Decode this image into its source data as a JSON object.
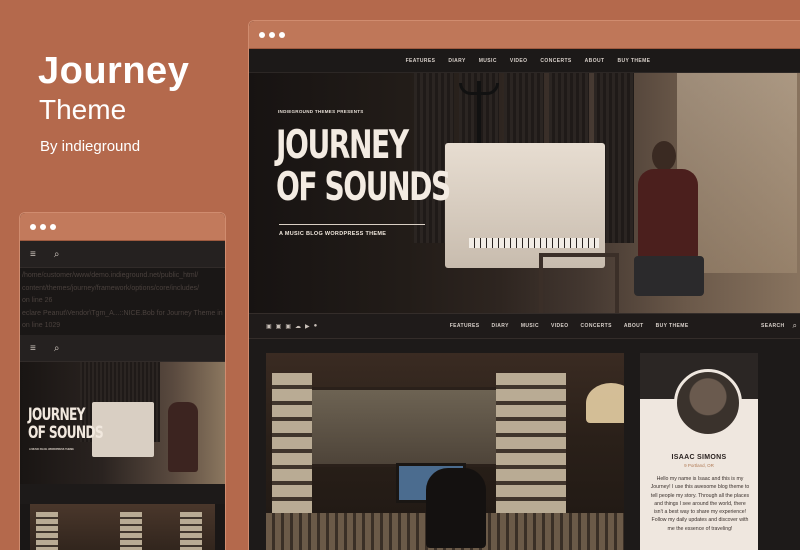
{
  "brand": {
    "title": "Journey",
    "subtitle": "Theme",
    "byline": "By indieground"
  },
  "desktop": {
    "top_nav": [
      "FEATURES",
      "DIARY",
      "MUSIC",
      "VIDEO",
      "CONCERTS",
      "ABOUT",
      "BUY THEME"
    ],
    "hero": {
      "presents": "INDIEGROUND THEMES PRESENTS",
      "title_line1": "JOURNEY",
      "title_line2": "OF SOUNDS",
      "tagline": "A MUSIC BLOG WORDPRESS THEME"
    },
    "sub_nav": [
      "FEATURES",
      "DIARY",
      "MUSIC",
      "VIDEO",
      "CONCERTS",
      "ABOUT",
      "BUY THEME"
    ],
    "search_label": "SEARCH",
    "social_icons": [
      "facebook",
      "twitter",
      "instagram",
      "soundcloud",
      "youtube",
      "spotify"
    ],
    "profile": {
      "name": "ISAAC SIMONS",
      "location": "9 Portland, OR",
      "bio": "Hello my name is Isaac and this is my Journey! I use this awesome blog theme to tell people my story. Through all the places and things I see around the world, there isn't a best way to share my experience! Follow my daily updates and discover with me the essence of traveling!"
    }
  },
  "mobile": {
    "menu_icon": "≡",
    "search_icon": "⌕",
    "error_lines": [
      "/home/customer/www/demo.indieground.net/public_html/",
      "content/themes/journey/framework/options/core/includes/",
      "on line 26",
      "eclare Peanut\\Vendor\\Tgm_A...::NICE.Bob for Journey Theme in",
      "on line 1029"
    ],
    "hero": {
      "title_line1": "JOURNEY",
      "title_line2": "OF SOUNDS",
      "tagline": "A MUSIC BLOG WORDPRESS THEME"
    }
  },
  "colors": {
    "background": "#b4694c",
    "frame_bar": "#c27a5c",
    "dark": "#1d1a19"
  }
}
